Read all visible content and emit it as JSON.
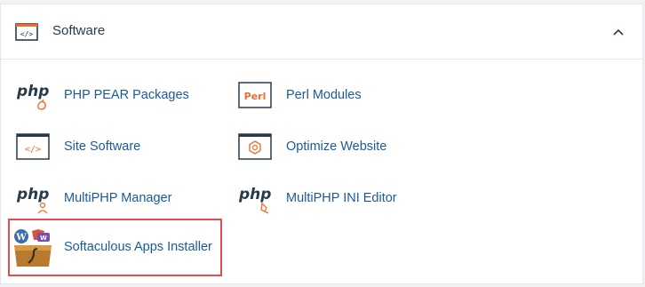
{
  "section": {
    "title": "Software"
  },
  "items": [
    {
      "label": "PHP PEAR Packages",
      "icon": "php-pear-icon"
    },
    {
      "label": "Perl Modules",
      "icon": "perl-icon",
      "icon_text": "Perl"
    },
    {
      "label": "Site Software",
      "icon": "code-window-icon"
    },
    {
      "label": "Optimize Website",
      "icon": "optimize-icon"
    },
    {
      "label": "MultiPHP Manager",
      "icon": "php-manager-icon"
    },
    {
      "label": "MultiPHP INI Editor",
      "icon": "php-ini-icon"
    },
    {
      "label": "Softaculous Apps Installer",
      "icon": "softaculous-icon"
    }
  ],
  "php_icon_text": "php",
  "colors": {
    "link": "#1a5a9c",
    "accent_orange": "#f26c2c",
    "highlight_border": "#e64c4c"
  }
}
